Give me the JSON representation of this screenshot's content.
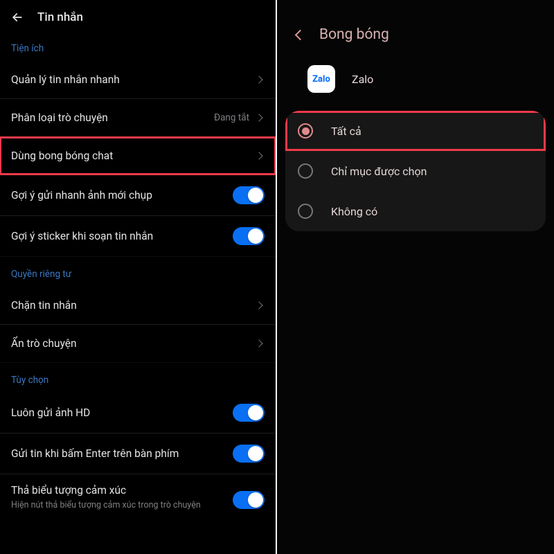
{
  "left": {
    "title": "Tin nhắn",
    "sections": {
      "utilities": {
        "header": "Tiện ích",
        "items": {
          "quickManage": "Quản lý tin nhắn nhanh",
          "classify": {
            "label": "Phân loại trò chuyện",
            "value": "Đang tắt"
          },
          "bubble": "Dùng bong bóng chat",
          "photoSuggest": "Gợi ý gửi nhanh ảnh mới chụp",
          "stickerSuggest": "Gợi ý sticker khi soạn tin nhắn"
        }
      },
      "privacy": {
        "header": "Quyền riêng tư",
        "items": {
          "block": "Chặn tin nhắn",
          "hideConv": "Ẩn trò chuyện"
        }
      },
      "options": {
        "header": "Tùy chọn",
        "items": {
          "hd": "Luôn gửi ảnh HD",
          "enter": "Gửi tin khi bấm Enter trên bàn phím",
          "emotion": {
            "label": "Thả biểu tượng cảm xúc",
            "sub": "Hiện nút thả biểu tượng cảm xúc trong trò chuyện"
          }
        }
      }
    }
  },
  "right": {
    "title": "Bong bóng",
    "app": {
      "icon": "Zalo",
      "name": "Zalo"
    },
    "options": {
      "all": "Tất cả",
      "selected": "Chỉ mục được chọn",
      "none": "Không có"
    }
  }
}
